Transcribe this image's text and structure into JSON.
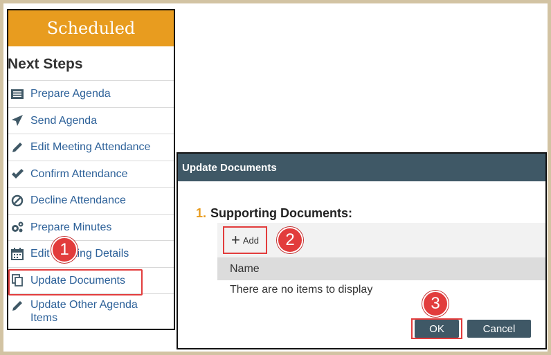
{
  "panel": {
    "status": "Scheduled",
    "next_steps_title": "Next Steps",
    "steps": [
      {
        "label": "Prepare Agenda",
        "icon": "list-icon"
      },
      {
        "label": "Send Agenda",
        "icon": "paper-plane-icon"
      },
      {
        "label": "Edit Meeting Attendance",
        "icon": "pencil-icon"
      },
      {
        "label": "Confirm Attendance",
        "icon": "checkmark-icon"
      },
      {
        "label": "Decline Attendance",
        "icon": "ban-icon"
      },
      {
        "label": "Prepare Minutes",
        "icon": "gears-icon"
      },
      {
        "label": "Edit Meeting Details",
        "icon": "calendar-icon"
      },
      {
        "label": "Update Documents",
        "icon": "documents-icon"
      },
      {
        "label": "Update Other Agenda Items",
        "icon": "pencil-icon"
      }
    ]
  },
  "dialog": {
    "title": "Update Documents",
    "section_number": "1.",
    "section_title": "Supporting Documents:",
    "add_label": "Add",
    "column_name": "Name",
    "empty_message": "There are no items to display",
    "ok_label": "OK",
    "cancel_label": "Cancel"
  },
  "callouts": [
    "1",
    "2",
    "3"
  ],
  "colors": {
    "frame": "#d2c3a3",
    "status_orange": "#e89c1f",
    "dialog_header": "#3f5866",
    "link_blue": "#2d6199",
    "callout_red": "#e23c3c"
  }
}
